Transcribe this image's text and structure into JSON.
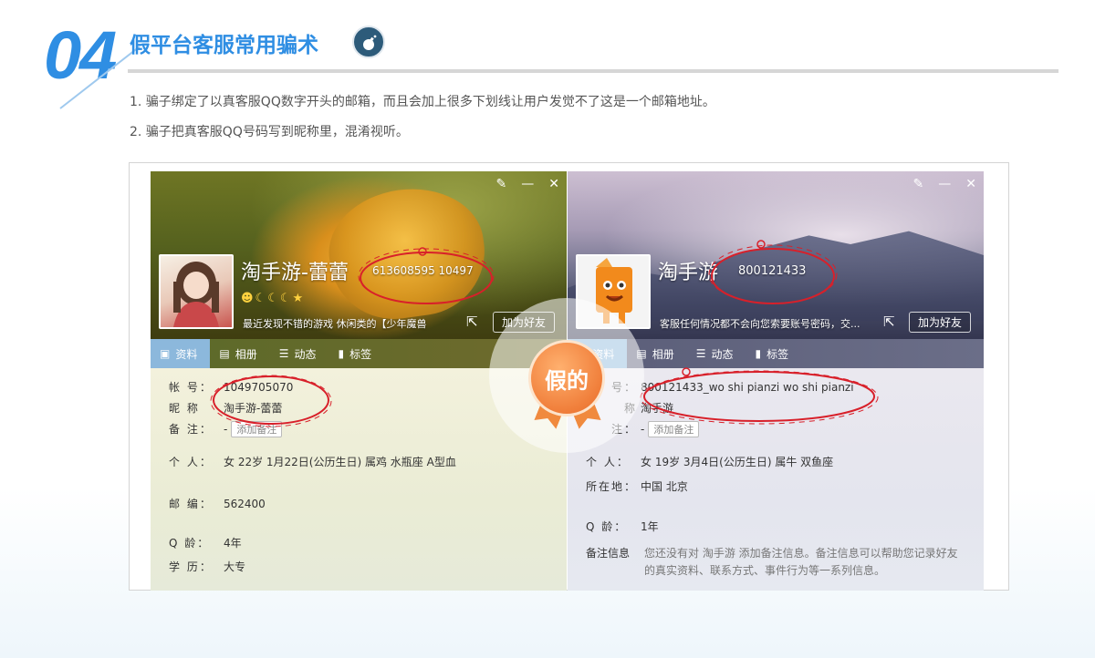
{
  "header": {
    "number": "04",
    "title": "假平台客服常用骗术"
  },
  "bullets": [
    "1. 骗子绑定了以真客服QQ数字开头的邮箱，而且会加上很多下划线让用户发觉不了这是一个邮箱地址。",
    "2. 骗子把真客服QQ号码写到昵称里，混淆视听。"
  ],
  "left_card": {
    "nickname": "淘手游-蕾蕾",
    "qq_display": "613608595 10497",
    "level_icons": "☻☾☾☾★",
    "signature": "最近发现不错的游戏 休闲类的【少年魔兽",
    "add_friend": "加为好友",
    "tabs": [
      "资料",
      "相册",
      "动态",
      "标签"
    ],
    "fields": {
      "account_label": "帐 号：",
      "account": "1049705070",
      "nick_label": "昵 称",
      "nick": "淘手游-蕾蕾",
      "note_label": "备 注：",
      "note": "-",
      "note_btn": "添加备注",
      "personal_label": "个 人：",
      "personal": "女 22岁 1月22日(公历生日) 属鸡 水瓶座 A型血",
      "postcode_label": "邮 编：",
      "postcode": "562400",
      "qage_label": "Q 龄：",
      "qage": "4年",
      "edu_label": "学 历：",
      "edu": "大专"
    }
  },
  "right_card": {
    "nickname": "淘手游",
    "qq_display": "800121433",
    "signature": "客服任何情况都不会向您索要账号密码，交...",
    "add_friend": "加为好友",
    "tabs": [
      "资料",
      "相册",
      "动态",
      "标签"
    ],
    "fields": {
      "account_label": "号：",
      "account": "800121433_wo shi pianzi wo shi pianzi",
      "nick_label": "称",
      "nick": "淘手游",
      "note_label": "注：",
      "note": "-",
      "note_btn": "添加备注",
      "personal_label": "个 人：",
      "personal": "女 19岁 3月4日(公历生日) 属牛 双鱼座",
      "location_label": "所在地：",
      "location": "中国 北京",
      "qage_label": "Q 龄：",
      "qage": "1年",
      "remark_label": "备注信息",
      "remark": "您还没有对 淘手游 添加备注信息。备注信息可以帮助您记录好友的真实资料、联系方式、事件行为等一系列信息。"
    }
  },
  "badge": {
    "text": "假的",
    "color": "#f07e3a"
  },
  "colors": {
    "accent": "#2f8ee3",
    "annotation": "#d8202a"
  },
  "icons": [
    "bomb-icon",
    "skin-icon",
    "minimize-icon",
    "close-icon",
    "share-icon",
    "profile-icon",
    "album-icon",
    "feed-icon",
    "tag-icon"
  ]
}
